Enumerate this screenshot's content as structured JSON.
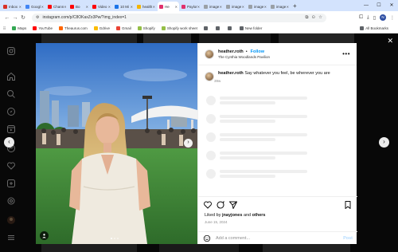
{
  "browser": {
    "tabs": [
      {
        "label": "Inbox",
        "color": "#d93025"
      },
      {
        "label": "Googl",
        "color": "#4285f4"
      },
      {
        "label": "Chann",
        "color": "#ff0000"
      },
      {
        "label": "Bo",
        "color": "#ff0000"
      },
      {
        "label": "Video",
        "color": "#ff0000"
      },
      {
        "label": "10 Mi",
        "color": "#1a73e8"
      },
      {
        "label": "health",
        "color": "#f4b400"
      },
      {
        "label": "He",
        "color": "#e1306c"
      },
      {
        "label": "Paylor",
        "color": "#e1306c"
      },
      {
        "label": "image",
        "color": "#9aa0a6"
      },
      {
        "label": "image",
        "color": "#9aa0a6"
      },
      {
        "label": "image",
        "color": "#9aa0a6"
      },
      {
        "label": "image",
        "color": "#9aa0a6"
      }
    ],
    "active_tab_index": 7,
    "url": "instagram.com/p/C8OKaxZo3Pw/?img_index=1",
    "profile_initial": "N"
  },
  "bookmarks": {
    "items": [
      {
        "label": "Maps",
        "color": "#34a853"
      },
      {
        "label": "YouTube",
        "color": "#ff0000"
      },
      {
        "label": "Theaurus.com",
        "color": "#ff6600"
      },
      {
        "label": "Gdrive",
        "color": "#fbbc04"
      },
      {
        "label": "Gmail",
        "color": "#ea4335"
      },
      {
        "label": "Shopify",
        "color": "#95bf47"
      },
      {
        "label": "Shopify work sheet",
        "color": "#95bf47"
      },
      {
        "label": "",
        "color": "#5f6368"
      },
      {
        "label": "",
        "color": "#5f6368"
      },
      {
        "label": "",
        "color": "#5f6368"
      },
      {
        "label": "New folder",
        "color": "#5f6368"
      }
    ],
    "all_label": "All Bookmarks"
  },
  "post": {
    "username": "heather.roth",
    "separator": "•",
    "follow_label": "Follow",
    "location": "The Cynthia Woodlands Pavilion",
    "caption": "Say whatever you feel, be wherever you are",
    "caption_age": "39w",
    "liked_by_prefix": "Liked by",
    "liked_by_user": "jnayjones",
    "liked_by_and": "and",
    "liked_by_suffix": "others",
    "date": "June 15, 2024",
    "comment_placeholder": "Add a comment...",
    "post_label": "Post",
    "more_label": "•••"
  },
  "colors": {
    "accent": "#0095f6",
    "sky": "#4a87d8",
    "grass": "#3f8a3a"
  }
}
